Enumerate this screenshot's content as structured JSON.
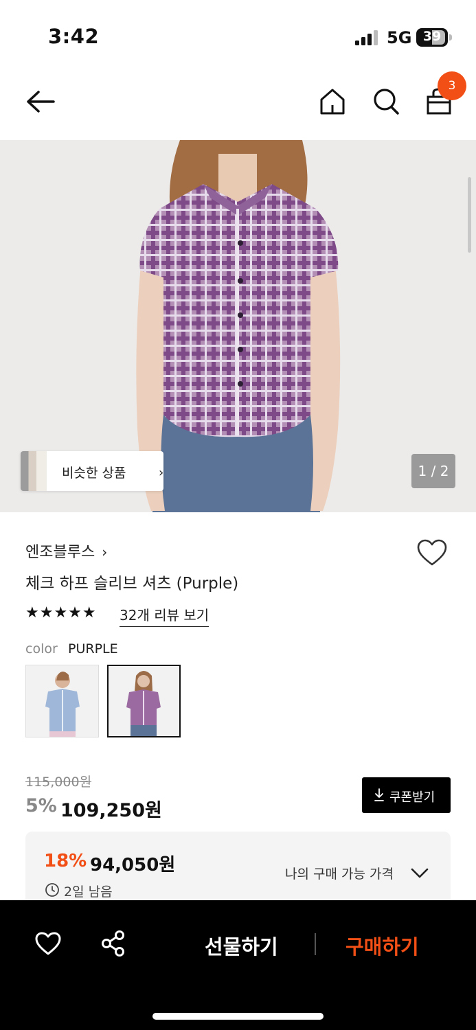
{
  "status_bar": {
    "time": "3:42",
    "network": "5G",
    "battery": "39"
  },
  "header": {
    "cart_count": "3"
  },
  "gallery": {
    "similar_label": "비슷한 상품",
    "pager": "1 / 2"
  },
  "product": {
    "brand": "엔조블루스",
    "title": "체크 하프 슬리브 셔츠 (Purple)",
    "stars": "★★★★★",
    "rating": 5,
    "reviews_link": "32개 리뷰 보기",
    "color_label": "color",
    "color_value": "PURPLE"
  },
  "pricing": {
    "original": "115,000원",
    "discount": "5%",
    "price": "109,250원",
    "coupon_button": "쿠폰받기",
    "best_pct": "18%",
    "best_price": "94,050원",
    "remaining": "2일 남음",
    "my_price_link": "나의 구매 가능 가격"
  },
  "bottom_bar": {
    "gift_label": "선물하기",
    "buy_label": "구매하기"
  },
  "colors": {
    "accent": "#f24f16",
    "dark": "#000000"
  }
}
